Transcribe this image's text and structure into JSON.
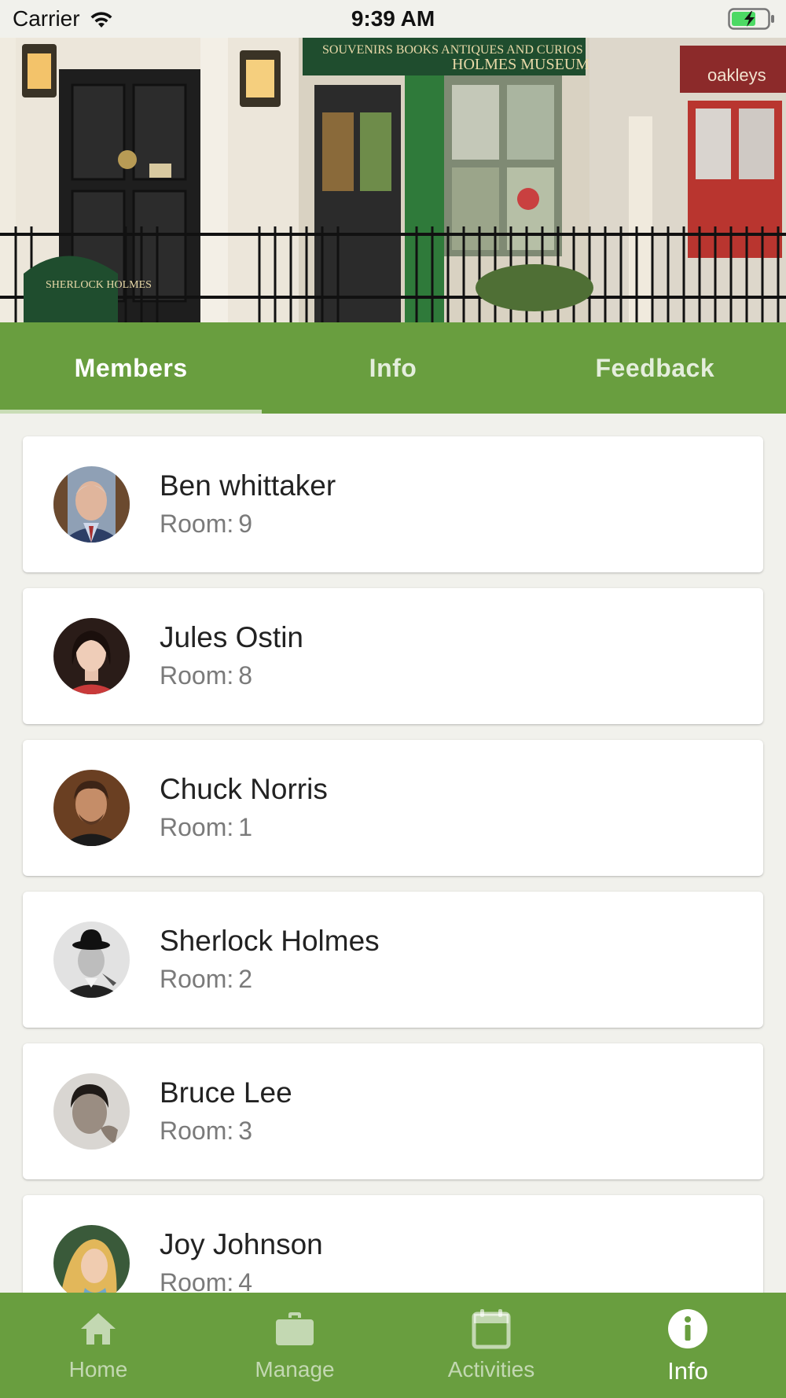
{
  "status_bar": {
    "carrier": "Carrier",
    "time": "9:39 AM"
  },
  "hero": {
    "sign_museum": "HOLMES MUSEUM",
    "sign_goods": "SOUVENIRS BOOKS ANTIQUES AND CURIOS",
    "sign_shop": "oakleys",
    "sign_board": "SHERLOCK HOLMES"
  },
  "tabs": [
    {
      "label": "Members",
      "active": true
    },
    {
      "label": "Info",
      "active": false
    },
    {
      "label": "Feedback",
      "active": false
    }
  ],
  "members": [
    {
      "name": "Ben whittaker",
      "room_label": "Room:",
      "room": "9"
    },
    {
      "name": "Jules Ostin",
      "room_label": "Room:",
      "room": "8"
    },
    {
      "name": "Chuck Norris",
      "room_label": "Room:",
      "room": "1"
    },
    {
      "name": "Sherlock Holmes",
      "room_label": "Room:",
      "room": "2"
    },
    {
      "name": "Bruce Lee",
      "room_label": "Room:",
      "room": "3"
    },
    {
      "name": "Joy Johnson",
      "room_label": "Room:",
      "room": "4"
    }
  ],
  "bottom_nav": [
    {
      "label": "Home",
      "icon": "home-icon",
      "active": false
    },
    {
      "label": "Manage",
      "icon": "briefcase-icon",
      "active": false
    },
    {
      "label": "Activities",
      "icon": "calendar-icon",
      "active": false
    },
    {
      "label": "Info",
      "icon": "info-icon",
      "active": true
    }
  ],
  "colors": {
    "primary": "#699e3f",
    "background": "#f1f1ec",
    "card": "#ffffff",
    "battery": "#4cd964"
  }
}
